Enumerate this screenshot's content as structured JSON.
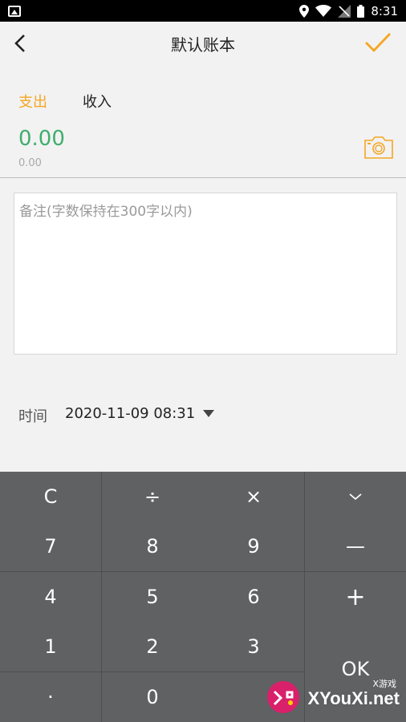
{
  "status_bar": {
    "time": "8:31",
    "icons": [
      "image-icon",
      "location-icon",
      "wifi-icon",
      "signal-icon",
      "battery-icon"
    ]
  },
  "header": {
    "title": "默认账本",
    "accent_color": "#f5a623"
  },
  "tabs": {
    "expense": "支出",
    "income": "收入"
  },
  "amount": {
    "main": "0.00",
    "sub": "0.00",
    "color": "#3fae6c"
  },
  "note": {
    "placeholder": "备注(字数保持在300字以内)"
  },
  "time_row": {
    "label": "时间",
    "value": "2020-11-09 08:31"
  },
  "keypad": {
    "row1": [
      "C",
      "÷",
      "×",
      "⌄"
    ],
    "row2": [
      "7",
      "8",
      "9",
      "—"
    ],
    "row3": [
      "4",
      "5",
      "6",
      "+"
    ],
    "row4": [
      "1",
      "2",
      "3"
    ],
    "row5": [
      "·",
      "0"
    ],
    "ok": "OK"
  },
  "watermark": {
    "site": "XYouXi.net",
    "small": "X游戏"
  }
}
